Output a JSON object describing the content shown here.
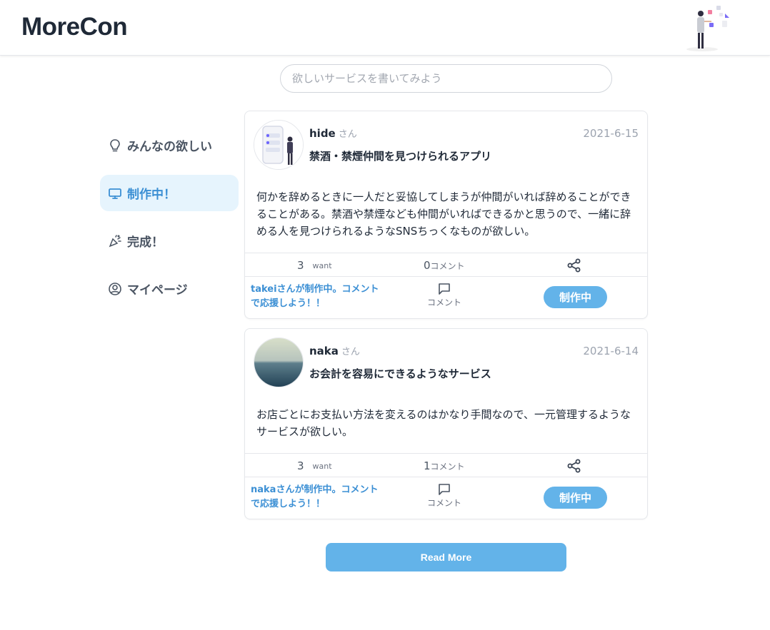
{
  "app": {
    "logo": "MoreCon"
  },
  "search": {
    "placeholder": "欲しいサービスを書いてみよう"
  },
  "sidebar": {
    "items": [
      {
        "label": "みんなの欲しい",
        "icon": "lightbulb-icon",
        "active": false
      },
      {
        "label": "制作中！",
        "icon": "monitor-icon",
        "active": true
      },
      {
        "label": "完成！",
        "icon": "party-popper-icon",
        "active": false
      },
      {
        "label": "マイページ",
        "icon": "user-circle-icon",
        "active": false
      }
    ]
  },
  "posts": [
    {
      "user": "hide",
      "honorific": "さん",
      "date": "2021-6-15",
      "title": "禁酒・禁煙仲間を見つけられるアプリ",
      "body": "何かを辞めるときに一人だと妥協してしまうが仲間がいれば辞めることができることがある。禁酒や禁煙なども仲間がいればできるかと思うので、一緒に辞める人を見つけられるようなSNSちっくなものが欲しい。",
      "want_count": "3",
      "want_label": "want",
      "comment_count": "0",
      "comment_label": "コメント",
      "progress_message": "takeiさんが制作中。コメントで応援しよう！！",
      "comment_button_label": "コメント",
      "status_label": "制作中"
    },
    {
      "user": "naka",
      "honorific": "さん",
      "date": "2021-6-14",
      "title": "お会計を容易にできるようなサービス",
      "body": "お店ごとにお支払い方法を変えるのはかなり手間なので、一元管理するようなサービスが欲しい。",
      "want_count": "3",
      "want_label": "want",
      "comment_count": "1",
      "comment_label": "コメント",
      "progress_message": "nakaさんが制作中。コメントで応援しよう！！",
      "comment_button_label": "コメント",
      "status_label": "制作中"
    }
  ],
  "read_more": "Read More",
  "colors": {
    "accent": "#63b3e9",
    "accent_text": "#3b8fd4",
    "active_bg": "#e6f4fd"
  }
}
